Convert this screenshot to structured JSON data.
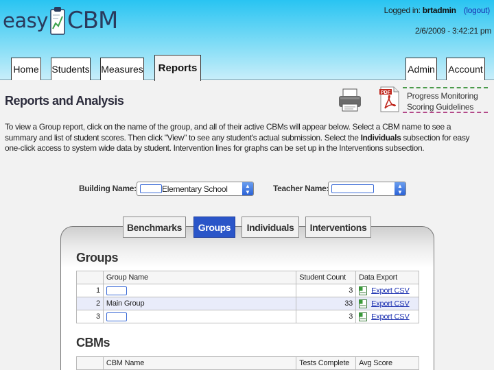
{
  "brand": {
    "logo_left": "easy",
    "logo_right": "CBM",
    "colors": {
      "header_top": "#29c4f2",
      "header_bottom": "#c8eefa",
      "active_tab": "#2a55c8"
    }
  },
  "session": {
    "logged_in_prefix": "Logged in:",
    "username": "brtadmin",
    "logout": "(logout)",
    "datetime": "2/6/2009 - 3:42:21 pm"
  },
  "nav": {
    "left": [
      "Home",
      "Students",
      "Measures",
      "Reports"
    ],
    "active": "Reports",
    "right": [
      "Admin",
      "Account"
    ]
  },
  "page": {
    "title": "Reports and Analysis",
    "print_icon": "printer-icon",
    "pdf_icon": "pdf-icon",
    "guidelines_line1": "Progress Monitoring",
    "guidelines_line2": "Scoring Guidelines",
    "intro_part1": "To view a Group report, click on the name of the group, and all of their active CBMs will appear below. Select a CBM name to see a summary and list of student scores. Then click \"View\" to see any student's actual submission. Select the ",
    "intro_bold": "Individuals",
    "intro_part2": " subsection for easy one-click access to system wide data by student. Intervention lines for graphs can be set up in the Interventions subsection."
  },
  "filters": {
    "building_label": "Building Name:",
    "building_value": "Elementary School",
    "teacher_label": "Teacher Name:",
    "teacher_value": ""
  },
  "subtabs": [
    "Benchmarks",
    "Groups",
    "Individuals",
    "Interventions"
  ],
  "subtab_active": "Groups",
  "groups": {
    "title": "Groups",
    "headers": [
      "",
      "Group Name",
      "Student Count",
      "Data Export"
    ],
    "rows": [
      {
        "index": "1",
        "name": "",
        "count": "3",
        "export": "Export CSV"
      },
      {
        "index": "2",
        "name": "Main Group",
        "count": "33",
        "export": "Export CSV"
      },
      {
        "index": "3",
        "name": "",
        "count": "3",
        "export": "Export CSV"
      }
    ]
  },
  "cbms": {
    "title": "CBMs",
    "headers": [
      "",
      "CBM Name",
      "Tests Complete",
      "Avg Score"
    ]
  }
}
